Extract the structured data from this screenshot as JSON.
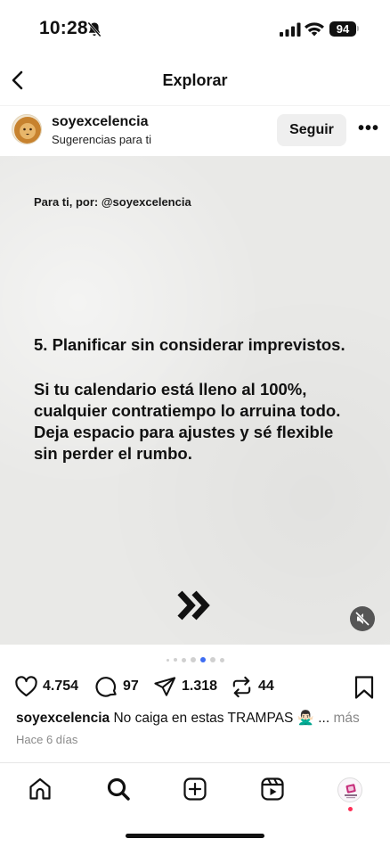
{
  "status_bar": {
    "time": "10:28",
    "battery": "94"
  },
  "header": {
    "title": "Explorar"
  },
  "post": {
    "username": "soyexcelencia",
    "subtitle": "Sugerencias para ti",
    "follow_label": "Seguir",
    "more_label": "•••",
    "media": {
      "credit": "Para ti, por: @soyexcelencia",
      "heading": "5. Planificar sin considerar imprevistos.",
      "body": [
        "Si tu calendario está lleno al 100%,",
        "cualquier contratiempo lo arruina todo.",
        "Deja espacio para ajustes y sé flexible",
        "sin perder el rumbo."
      ]
    },
    "carousel": {
      "total": 7,
      "active": 5
    },
    "counts": {
      "likes": "4.754",
      "comments": "97",
      "shares": "1.318",
      "reposts": "44"
    },
    "caption": {
      "user": "soyexcelencia",
      "text": " No caiga en estas TRAMPAS 🙅🏻‍♂️ ...",
      "more": " más"
    },
    "date": "Hace 6 días"
  },
  "colors": {
    "accent": "#3e6df2",
    "notification": "#ff2d55"
  },
  "icons": [
    "bell-off-icon",
    "signal-icon",
    "wifi-icon",
    "back-icon",
    "more-icon",
    "chevrons-icon",
    "mute-icon",
    "heart-icon",
    "comment-icon",
    "send-icon",
    "repost-icon",
    "bookmark-icon",
    "home-icon",
    "search-icon",
    "create-icon",
    "reels-icon",
    "profile-icon"
  ]
}
